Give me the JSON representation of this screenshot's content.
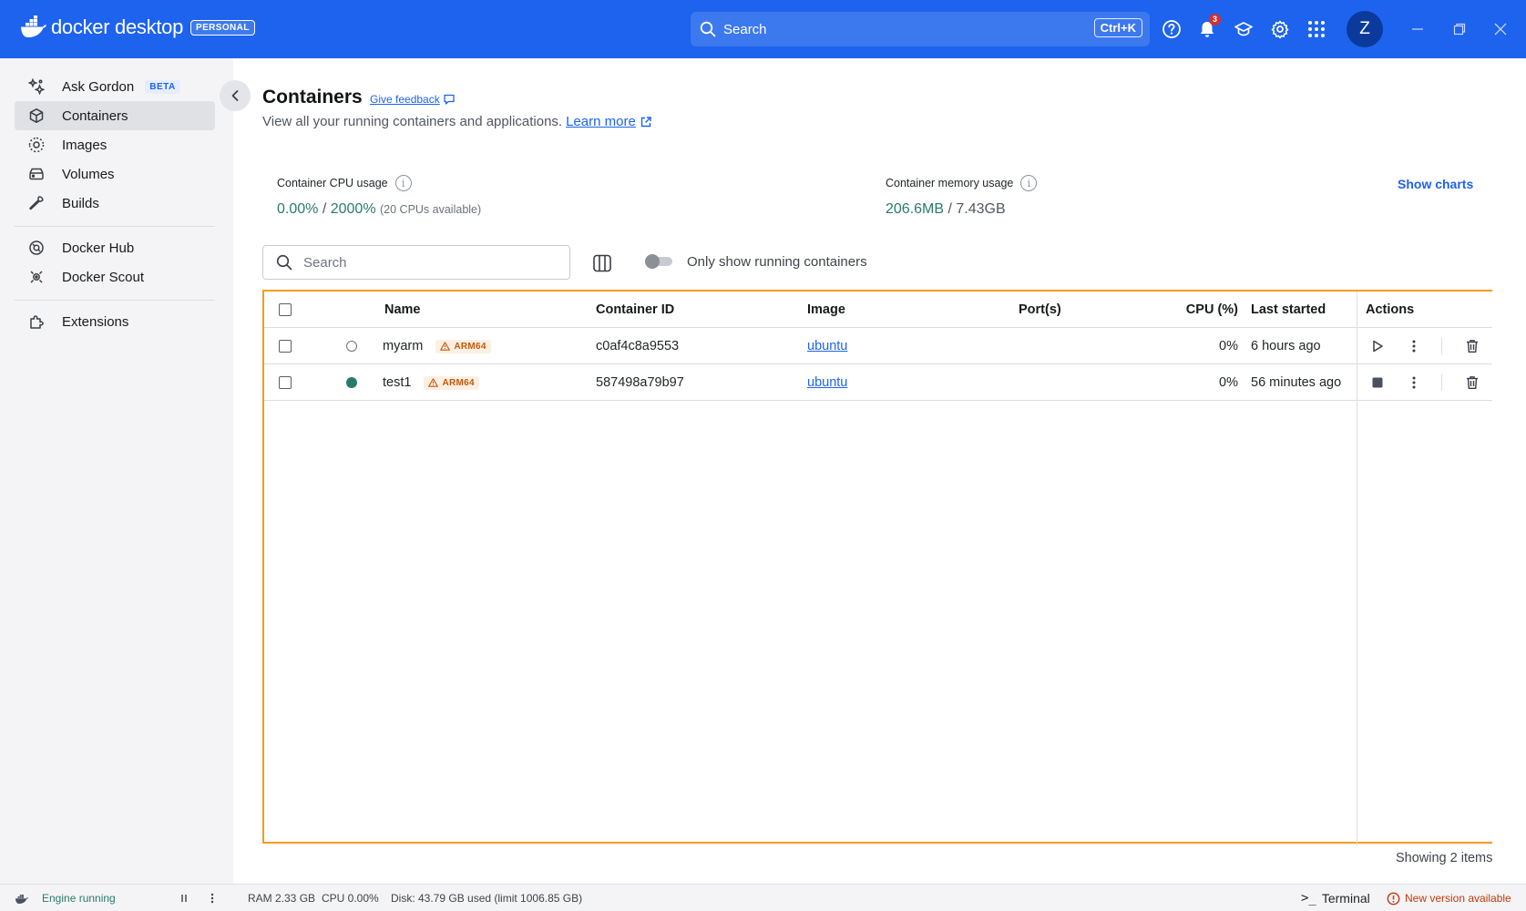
{
  "app": {
    "brand": "docker desktop",
    "plan_badge": "PERSONAL"
  },
  "topbar": {
    "search_label": "Search",
    "search_shortcut": "Ctrl+K",
    "notification_count": "3",
    "avatar_initial": "Z"
  },
  "sidebar": {
    "items": [
      {
        "label": "Ask Gordon",
        "badge": "BETA",
        "icon": "sparkle-icon"
      },
      {
        "label": "Containers",
        "icon": "cube-icon",
        "active": true
      },
      {
        "label": "Images",
        "icon": "images-icon"
      },
      {
        "label": "Volumes",
        "icon": "volume-icon"
      },
      {
        "label": "Builds",
        "icon": "wrench-icon"
      },
      {
        "label": "Docker Hub",
        "icon": "hub-icon"
      },
      {
        "label": "Docker Scout",
        "icon": "scout-icon"
      },
      {
        "label": "Extensions",
        "icon": "puzzle-icon"
      }
    ]
  },
  "page": {
    "title": "Containers",
    "feedback_label": "Give feedback",
    "subtitle": "View all your running containers and applications.",
    "learn_more": "Learn more"
  },
  "metrics": {
    "cpu_label": "Container CPU usage",
    "cpu_value": "0.00%",
    "cpu_max": "2000%",
    "cpu_note": "(20 CPUs available)",
    "mem_label": "Container memory usage",
    "mem_value": "206.6MB",
    "mem_max": "7.43GB",
    "show_charts": "Show charts"
  },
  "filters": {
    "search_placeholder": "Search",
    "toggle_label": "Only show running containers",
    "toggle_on": false
  },
  "table": {
    "columns": [
      "Name",
      "Container ID",
      "Image",
      "Port(s)",
      "CPU (%)",
      "Last started",
      "Actions"
    ],
    "rows": [
      {
        "name": "myarm",
        "arch": "ARM64",
        "status": "stopped",
        "id": "c0af4c8a9553",
        "image": "ubuntu",
        "ports": "",
        "cpu": "0%",
        "last_started": "6 hours ago",
        "primary_action": "play-icon"
      },
      {
        "name": "test1",
        "arch": "ARM64",
        "status": "running",
        "id": "587498a79b97",
        "image": "ubuntu",
        "ports": "",
        "cpu": "0%",
        "last_started": "56 minutes ago",
        "primary_action": "stop-icon"
      }
    ],
    "showing": "Showing 2 items"
  },
  "footer": {
    "engine_status": "Engine running",
    "ram": "RAM 2.33 GB",
    "cpu": "CPU 0.00%",
    "disk": "Disk: 43.79 GB used (limit 1006.85 GB)",
    "terminal": "Terminal",
    "new_version": "New version available"
  },
  "colors": {
    "brand_blue": "#1d63ed",
    "running_green": "#2a7a6b",
    "highlight_orange": "#f39c1a",
    "warning_orange": "#c4570c"
  }
}
